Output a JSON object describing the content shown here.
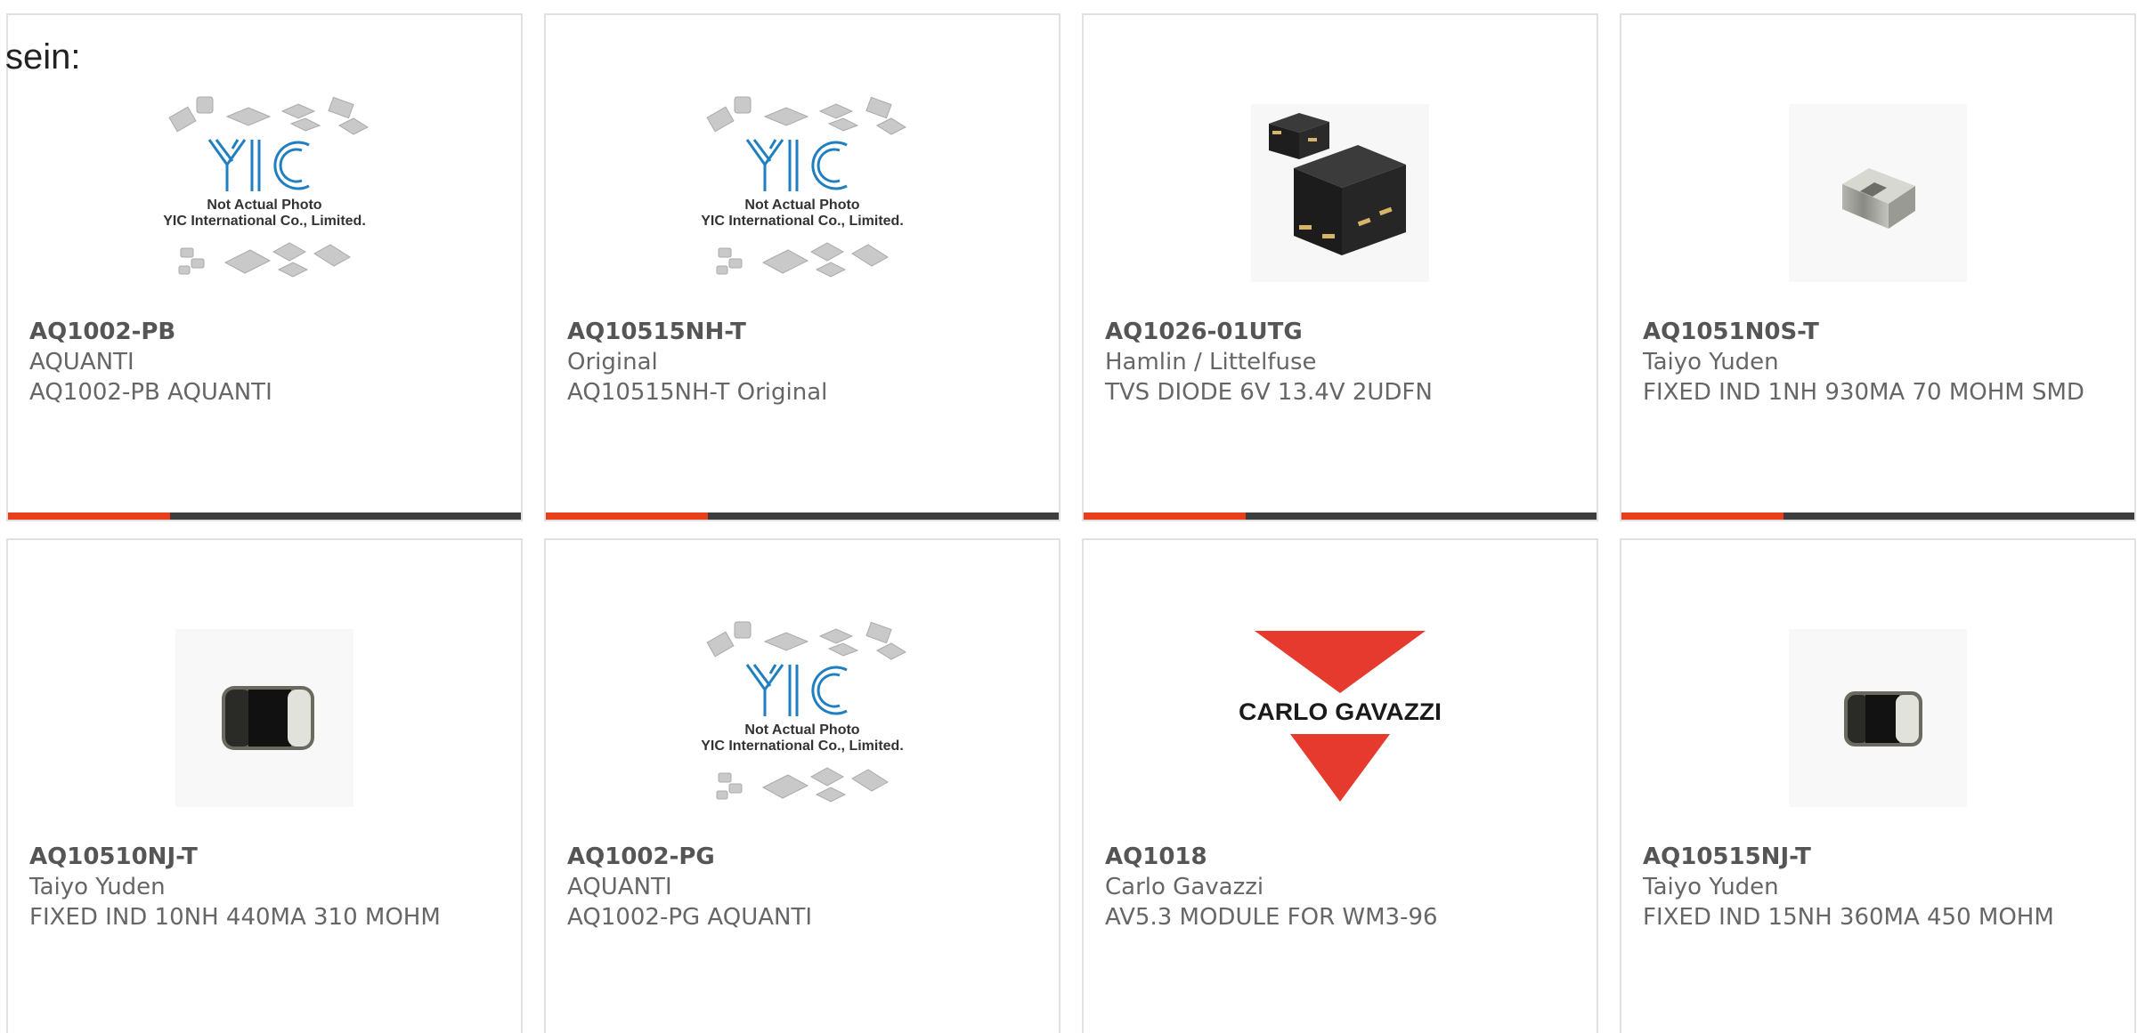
{
  "intro_text": "sein:",
  "colors": {
    "accent": "#e8401c",
    "bar": "#3d3d3d",
    "card_border": "#e1e1e1",
    "carlo_red": "#e63a2e"
  },
  "placeholder": {
    "line1": "Not Actual Photo",
    "line2": "YIC International Co., Limited."
  },
  "logo_text": "CARLO GAVAZZI",
  "products": [
    {
      "part": "AQ1002-PB",
      "maker": "AQUANTI",
      "desc": "AQ1002-PB AQUANTI",
      "image": "placeholder-icon"
    },
    {
      "part": "AQ10515NH-T",
      "maker": "Original",
      "desc": "AQ10515NH-T Original",
      "image": "placeholder-icon"
    },
    {
      "part": "AQ1026-01UTG",
      "maker": "Hamlin / Littelfuse",
      "desc": "TVS DIODE 6V 13.4V 2UDFN",
      "image": "diode-package-icon"
    },
    {
      "part": "AQ1051N0S-T",
      "maker": "Taiyo Yuden",
      "desc": "FIXED IND 1NH 930MA 70 MOHM SMD",
      "image": "inductor-chip-icon"
    },
    {
      "part": "AQ10510NJ-T",
      "maker": "Taiyo Yuden",
      "desc": "FIXED IND 10NH 440MA 310 MOHM",
      "image": "inductor-chip-icon"
    },
    {
      "part": "AQ1002-PG",
      "maker": "AQUANTI",
      "desc": "AQ1002-PG AQUANTI",
      "image": "placeholder-icon"
    },
    {
      "part": "AQ1018",
      "maker": "Carlo Gavazzi",
      "desc": "AV5.3 MODULE FOR WM3-96",
      "image": "carlo-gavazzi-logo"
    },
    {
      "part": "AQ10515NJ-T",
      "maker": "Taiyo Yuden",
      "desc": "FIXED IND 15NH 360MA 450 MOHM",
      "image": "inductor-chip-icon"
    }
  ]
}
